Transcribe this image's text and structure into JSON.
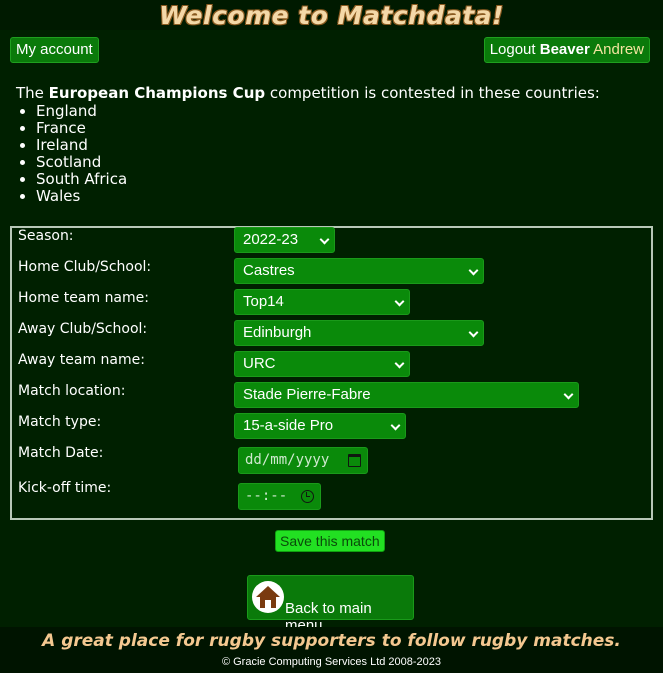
{
  "header": {
    "title": "Welcome to Matchdata!"
  },
  "account": {
    "my_account_label": "My account",
    "logout_label": "Logout",
    "user_first": "Beaver",
    "user_last": "Andrew"
  },
  "intro": {
    "prefix": "The ",
    "competition": "European Champions Cup",
    "suffix": " competition is contested in these countries:",
    "countries": [
      "England",
      "France",
      "Ireland",
      "Scotland",
      "South Africa",
      "Wales"
    ]
  },
  "form": {
    "season": {
      "label": "Season:",
      "value": "2022-23"
    },
    "home_club": {
      "label": "Home Club/School:",
      "value": "Castres"
    },
    "home_team": {
      "label": "Home team name:",
      "value": "Top14"
    },
    "away_club": {
      "label": "Away Club/School:",
      "value": "Edinburgh"
    },
    "away_team": {
      "label": "Away team name:",
      "value": "URC"
    },
    "location": {
      "label": "Match location:",
      "value": "Stade Pierre-Fabre"
    },
    "match_type": {
      "label": "Match type:",
      "value": "15-a-side Pro"
    },
    "match_date": {
      "label": "Match Date:",
      "placeholder": "dd/mm/yyyy"
    },
    "kickoff": {
      "label": "Kick-off time:",
      "placeholder": "--:--"
    }
  },
  "actions": {
    "save_label": "Save this match",
    "back_label": "Back to main menu"
  },
  "footer": {
    "tagline": "A great place for rugby supporters to follow rugby matches.",
    "copyright": "© Gracie Computing Services Ltd 2008-2023"
  }
}
